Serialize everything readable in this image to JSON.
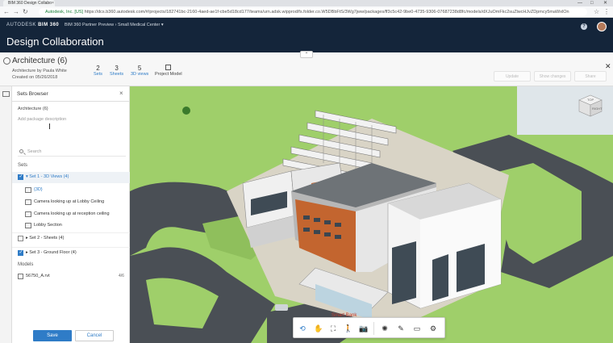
{
  "browser": {
    "tab_title": "BIM 360 Design Collabo",
    "tab_close": "×",
    "url_secure": "Autodesk, Inc. [US]",
    "url": "https://dcs.b360.autodesk.com/#/projects/182741bc-2160-4aed-ae1f-cbe5d18cd177/teams/urn.adsk.wipprod/fs.folder.co.W5DBbFtS/3Wg7jww/packages/ff3c5c42-9be0-4735-9306-07687238d8fc/models/dXJuOmFkc2suZlwcHJvZDpmcy5maWxlOn",
    "minimize": "—",
    "maximize": "□",
    "close": "✕"
  },
  "app": {
    "brand_prefix": "AUTODESK",
    "brand_product": "BIM 360",
    "project_crumb": "BIM 360 Partner Preview › Small Medical Center ▾",
    "title": "Design Collaboration",
    "help": "?"
  },
  "package": {
    "title": "Architecture (6)",
    "author": "Architecture by Paula White",
    "created": "Created on 05/26/2018",
    "stats": [
      {
        "num": "2",
        "label": "Sets"
      },
      {
        "num": "3",
        "label": "Sheets"
      },
      {
        "num": "5",
        "label": "3D views"
      }
    ],
    "project_model": "Project Model",
    "ghost_buttons": [
      "Update",
      "Show changes",
      "Share"
    ],
    "close": "✕",
    "collapse": "⌃"
  },
  "panel": {
    "title": "Sets Browser",
    "close": "×",
    "package_name": "Architecture (6)",
    "description_placeholder": "Add package description",
    "search_placeholder": "Search",
    "sets_header": "Sets",
    "sets": [
      {
        "label": "Set 1 - 3D Views (4)",
        "checked": true,
        "selected": true
      },
      {
        "label": "Set 2 - Sheets (4)",
        "checked": false,
        "selected": false
      },
      {
        "label": "Set 3 - Ground Floor (4)",
        "checked": true,
        "selected": false
      }
    ],
    "views": [
      {
        "label": "{3D}"
      },
      {
        "label": "Camera looking up at Lobby Ceiling"
      },
      {
        "label": "Camera looking up at reception ceiling"
      },
      {
        "label": "Lobby Section"
      }
    ],
    "models_header": "Models",
    "models": [
      {
        "label": "56750_A.rvt",
        "count": "4/6"
      }
    ],
    "save_label": "Save",
    "cancel_label": "Cancel"
  },
  "viewer": {
    "viewcube_top": "TOP",
    "viewcube_right": "RIGHT",
    "signage": "Smart Bank",
    "tools": [
      {
        "name": "orbit-tool",
        "glyph": "⟲",
        "active": true
      },
      {
        "name": "pan-tool",
        "glyph": "✋",
        "active": false
      },
      {
        "name": "fit-view-tool",
        "glyph": "⛶",
        "active": false
      },
      {
        "name": "first-person-tool",
        "glyph": "🚶",
        "active": false
      },
      {
        "name": "camera-tool",
        "glyph": "📷",
        "active": false
      },
      {
        "name": "explode-tool",
        "glyph": "✺",
        "active": false
      },
      {
        "name": "measure-tool",
        "glyph": "✎",
        "active": false
      },
      {
        "name": "section-tool",
        "glyph": "▭",
        "active": false
      },
      {
        "name": "settings-tool",
        "glyph": "⚙",
        "active": false
      }
    ]
  },
  "colors": {
    "header_bg": "#14253a",
    "accent": "#2f7cc7",
    "grass": "#9fcf6a",
    "asphalt": "#4a4f55",
    "brick": "#c3652f"
  }
}
